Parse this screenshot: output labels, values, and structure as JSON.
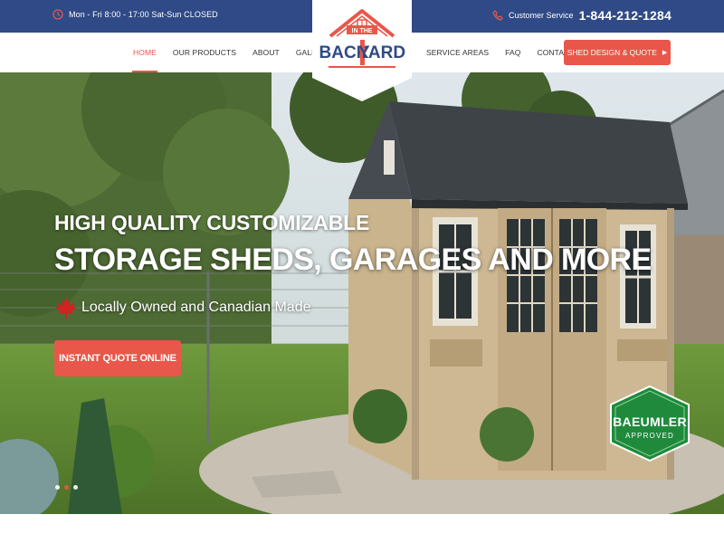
{
  "topbar": {
    "hours": "Mon - Fri 8:00 - 17:00 Sat-Sun CLOSED",
    "service_label": "Customer Service",
    "phone": "1-844-212-1284",
    "bg_color": "#2f4a86"
  },
  "nav": {
    "left_items": [
      {
        "label": "HOME",
        "active": true
      },
      {
        "label": "OUR PRODUCTS",
        "active": false
      },
      {
        "label": "ABOUT",
        "active": false
      },
      {
        "label": "GALLERY",
        "active": false
      }
    ],
    "right_items": [
      {
        "label": "SERVICE AREAS"
      },
      {
        "label": "FAQ"
      },
      {
        "label": "CONTACT"
      }
    ],
    "cta_label": "SHED DESIGN & QUOTE",
    "accent_color": "#e8574a"
  },
  "logo": {
    "line1": "IN THE",
    "line2a": "BACK",
    "line2b": "YARD"
  },
  "hero": {
    "subheading": "HIGH QUALITY CUSTOMIZABLE",
    "heading": "STORAGE SHEDS, GARAGES AND MORE",
    "tagline": "Locally Owned and Canadian Made",
    "button_label": "INSTANT QUOTE ONLINE",
    "slides": [
      {
        "active": true
      },
      {
        "active": false
      },
      {
        "active": false
      }
    ]
  },
  "badge": {
    "line1": "BAEUMLER",
    "line2": "APPROVED"
  },
  "icons": [
    "clock-icon",
    "phone-icon",
    "chevron-right-icon",
    "maple-leaf-icon"
  ]
}
